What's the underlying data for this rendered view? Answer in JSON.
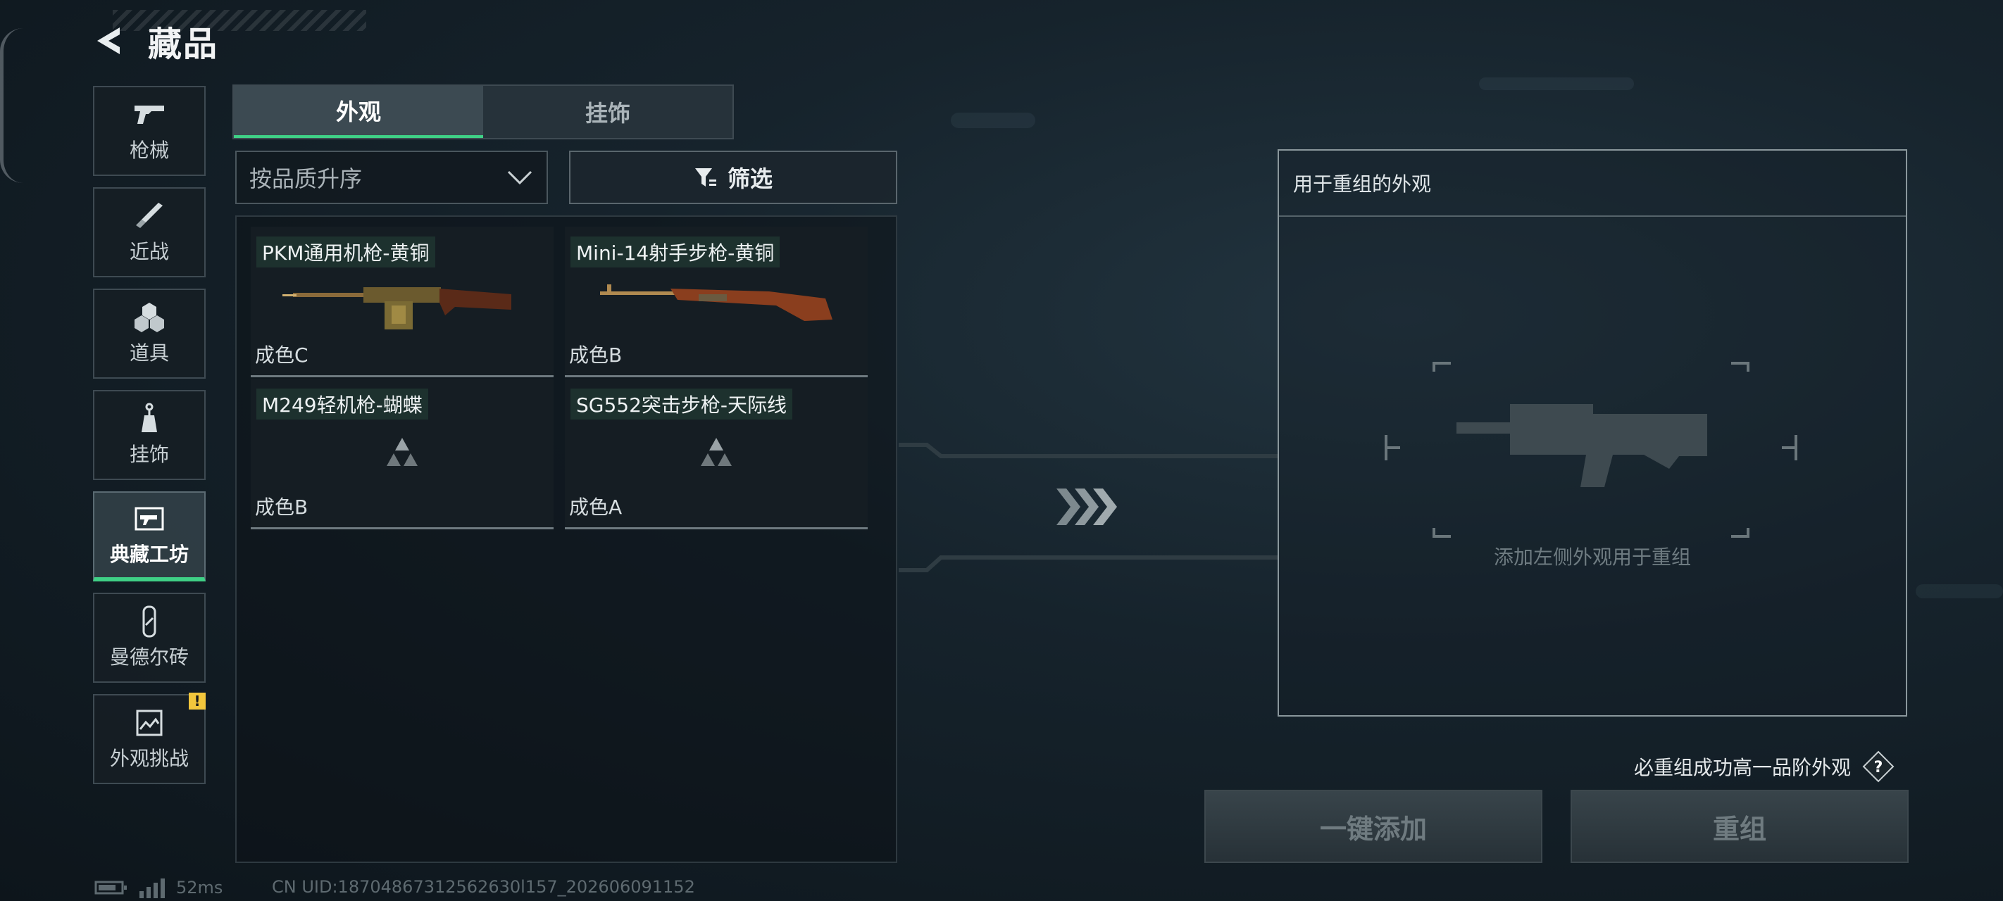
{
  "header": {
    "title": "藏品"
  },
  "side_nav": [
    {
      "label": "枪械",
      "icon": "gun-icon",
      "active": false
    },
    {
      "label": "近战",
      "icon": "knife-icon",
      "active": false
    },
    {
      "label": "道具",
      "icon": "grenade-icon",
      "active": false
    },
    {
      "label": "挂饰",
      "icon": "charm-icon",
      "active": false
    },
    {
      "label": "典藏工坊",
      "icon": "workshop-icon",
      "active": true
    },
    {
      "label": "曼德尔砖",
      "icon": "mandel-brick-icon",
      "active": false
    },
    {
      "label": "外观挑战",
      "icon": "challenge-icon",
      "active": false,
      "badge": "!"
    }
  ],
  "tabs": [
    {
      "label": "外观",
      "active": true
    },
    {
      "label": "挂饰",
      "active": false
    }
  ],
  "sort": {
    "selected": "按品质升序"
  },
  "filter": {
    "label": "筛选"
  },
  "items": [
    {
      "name": "PKM通用机枪-黄铜",
      "condition": "成色C",
      "image": "pkm-gun"
    },
    {
      "name": "Mini-14射手步枪-黄铜",
      "condition": "成色B",
      "image": "mini14-rifle"
    },
    {
      "name": "M249轻机枪-蝴蝶",
      "condition": "成色B",
      "image": "placeholder"
    },
    {
      "name": "SG552突击步枪-天际线",
      "condition": "成色A",
      "image": "placeholder"
    }
  ],
  "remix": {
    "header": "用于重组的外观",
    "hint": "添加左侧外观用于重组"
  },
  "guarantee": {
    "text": "必重组成功高一品阶外观",
    "help": "?"
  },
  "buttons": {
    "quick_add": "一键添加",
    "recombine": "重组"
  },
  "status": {
    "ping": "52ms",
    "uid": "CN UID:18704867312562630l157_202606091152"
  },
  "colors": {
    "accent": "#3fd086",
    "badge": "#f2c63c"
  }
}
